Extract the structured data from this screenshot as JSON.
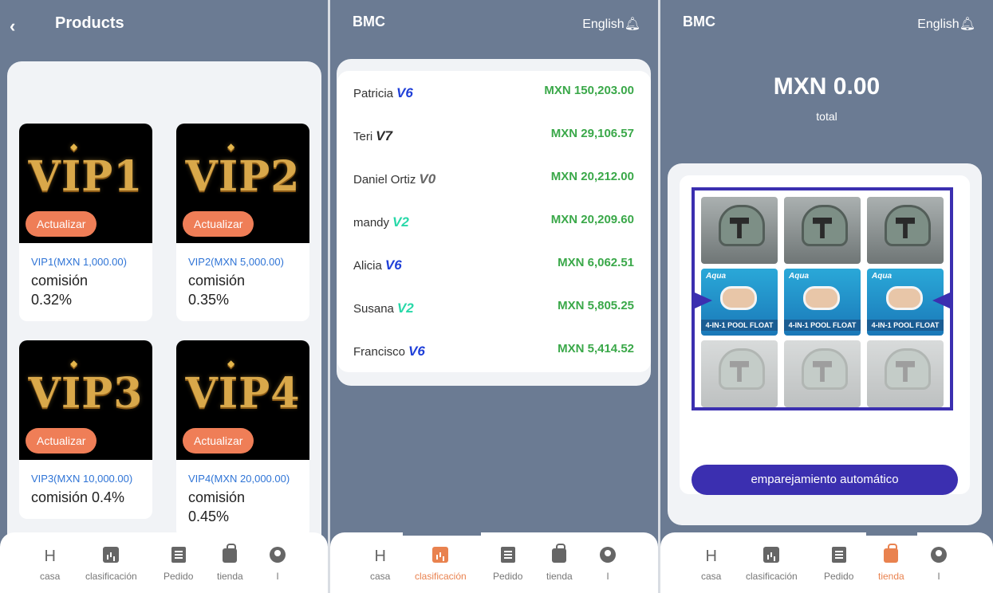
{
  "products_screen": {
    "title": "Products",
    "cards": [
      {
        "logo": "VIP1",
        "button": "Actualizar",
        "price": "VIP1(MXN 1,000.00)",
        "commission": "comisión 0.32%"
      },
      {
        "logo": "VIP2",
        "button": "Actualizar",
        "price": "VIP2(MXN 5,000.00)",
        "commission": "comisión 0.35%"
      },
      {
        "logo": "VIP3",
        "button": "Actualizar",
        "price": "VIP3(MXN 10,000.00)",
        "commission": "comisión 0.4%"
      },
      {
        "logo": "VIP4",
        "button": "Actualizar",
        "price": "VIP4(MXN 20,000.00)",
        "commission": "comisión 0.45%"
      }
    ]
  },
  "header": {
    "brand": "BMC",
    "language": "English"
  },
  "ranking": [
    {
      "name": "Patricia",
      "level": "V6",
      "amount": "MXN 150,203.00",
      "color": "#1f3fd8"
    },
    {
      "name": "Teri",
      "level": "V7",
      "amount": "MXN 29,106.57",
      "color": "#2b2b2b"
    },
    {
      "name": "Daniel Ortiz",
      "level": "V0",
      "amount": "MXN 20,212.00",
      "color": "#666666"
    },
    {
      "name": "mandy",
      "level": "V2",
      "amount": "MXN 20,209.60",
      "color": "#27d8a8"
    },
    {
      "name": "Alicia",
      "level": "V6",
      "amount": "MXN 6,062.51",
      "color": "#1f3fd8"
    },
    {
      "name": "Susana",
      "level": "V2",
      "amount": "MXN 5,805.25",
      "color": "#27d8a8"
    },
    {
      "name": "Francisco",
      "level": "V6",
      "amount": "MXN 5,414.52",
      "color": "#1f3fd8"
    }
  ],
  "shop": {
    "total_amount": "MXN 0.00",
    "total_label": "total",
    "product_brand": "Aqua",
    "product_label": "4-IN-1 POOL FLOAT",
    "match_button": "emparejamiento automático"
  },
  "tabs": [
    {
      "label": "casa",
      "icon": "h-icon"
    },
    {
      "label": "clasificación",
      "icon": "chart-icon"
    },
    {
      "label": "Pedido",
      "icon": "document-icon"
    },
    {
      "label": "tienda",
      "icon": "shopping-bag-icon"
    },
    {
      "label": "I",
      "icon": "user-icon"
    }
  ],
  "colors": {
    "background": "#6b7b93",
    "accent": "#e9824f",
    "primary_button": "#3b2fb0",
    "amount_green": "#3aa849"
  }
}
